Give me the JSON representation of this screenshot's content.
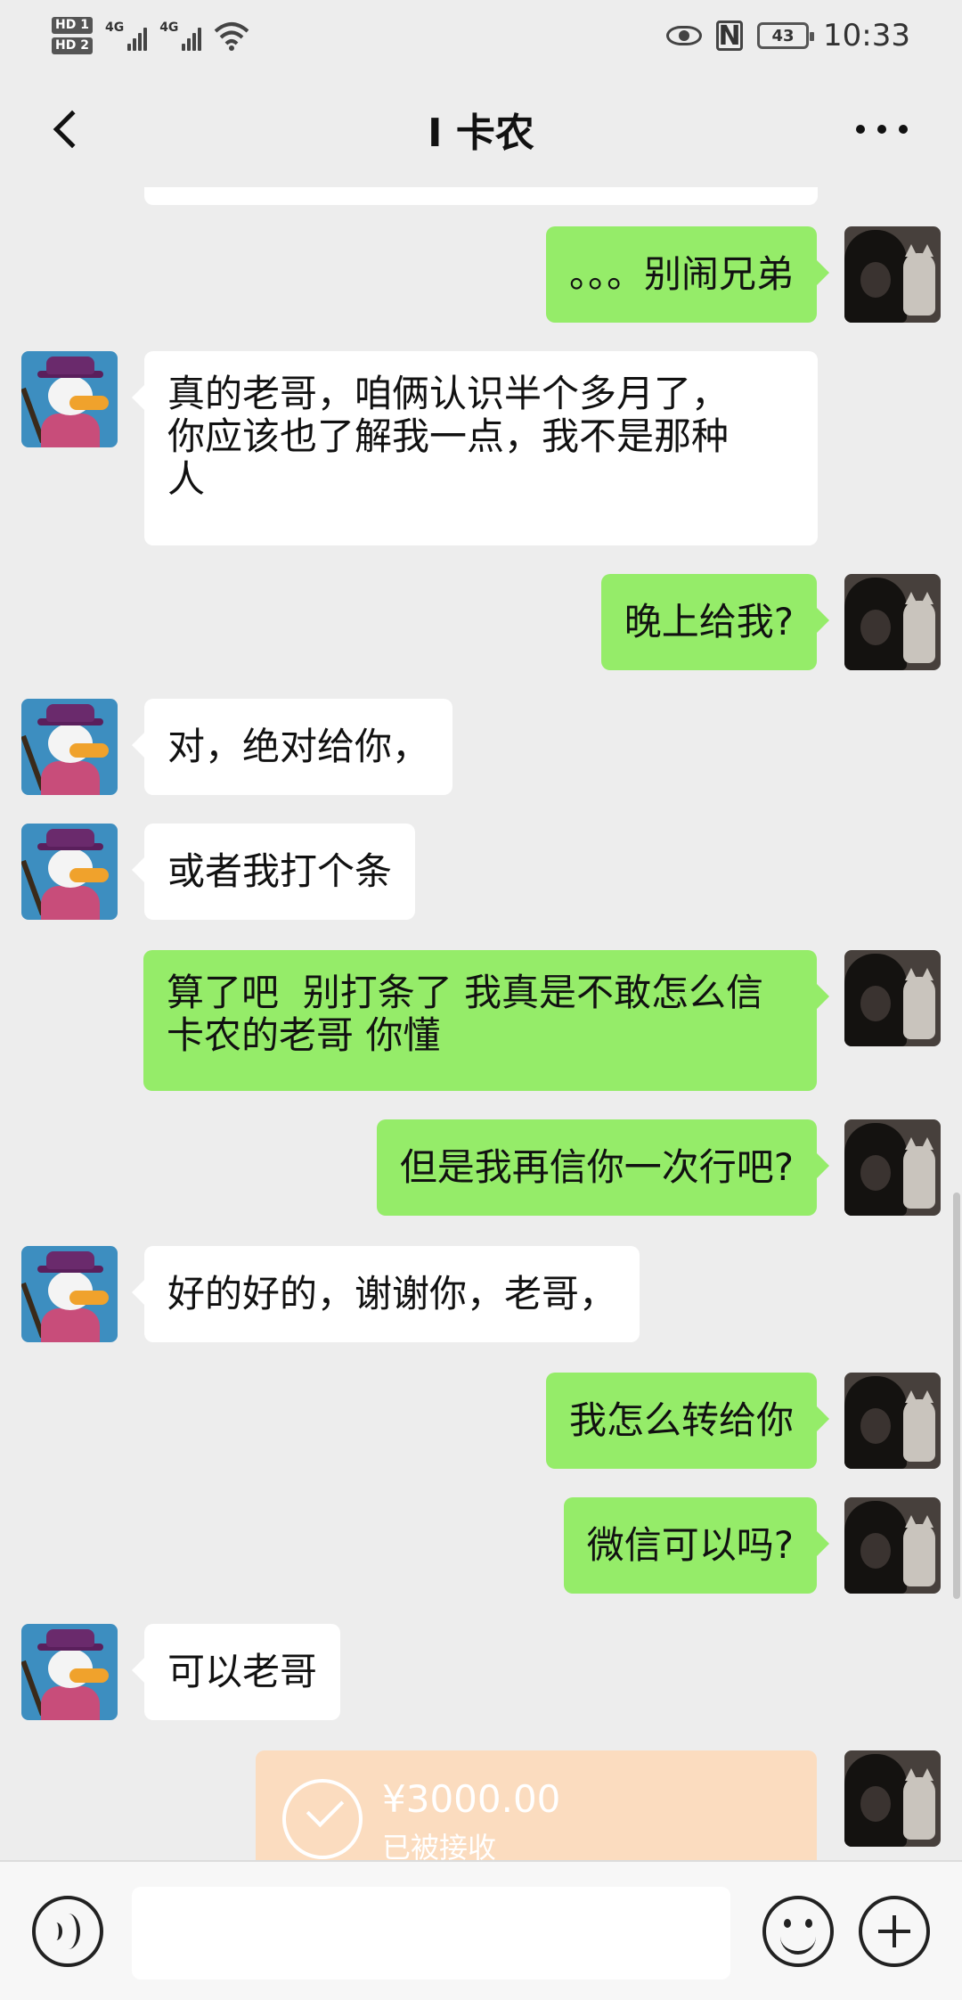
{
  "status_bar": {
    "hd1": "HD 1",
    "hd2": "HD 2",
    "net1": "4G",
    "net2": "4G",
    "battery": "43",
    "time": "10:33"
  },
  "header": {
    "title": "I 卡农"
  },
  "messages": [
    {
      "id": "m1",
      "side": "out",
      "text": "。。。别闹兄弟"
    },
    {
      "id": "m2",
      "side": "in",
      "text": "真的老哥，咱俩认识半个多月了，\n你应该也了解我一点，我不是那种\n人"
    },
    {
      "id": "m3",
      "side": "out",
      "text": "晚上给我?"
    },
    {
      "id": "m4",
      "side": "in",
      "text": "对，绝对给你，"
    },
    {
      "id": "m5",
      "side": "in",
      "text": "或者我打个条"
    },
    {
      "id": "m6",
      "side": "out",
      "text": "算了吧  别打条了 我真是不敢怎么信\n卡农的老哥 你懂"
    },
    {
      "id": "m7",
      "side": "out",
      "text": "但是我再信你一次行吧?"
    },
    {
      "id": "m8",
      "side": "in",
      "text": "好的好的，谢谢你，老哥，"
    },
    {
      "id": "m9",
      "side": "out",
      "text": "我怎么转给你"
    },
    {
      "id": "m10",
      "side": "out",
      "text": "微信可以吗?"
    },
    {
      "id": "m11",
      "side": "in",
      "text": "可以老哥"
    }
  ],
  "transfer": {
    "amount": "¥3000.00",
    "status": "已被接收"
  },
  "colors": {
    "background": "#ededed",
    "bubble_out": "#95ec69",
    "bubble_in": "#ffffff",
    "transfer_card": "#fbdcbf"
  },
  "icons": [
    "back-chevron-icon",
    "more-icon",
    "voice-icon",
    "emoji-icon",
    "plus-icon",
    "eye-icon",
    "nfc-icon",
    "wifi-icon",
    "battery-icon"
  ]
}
